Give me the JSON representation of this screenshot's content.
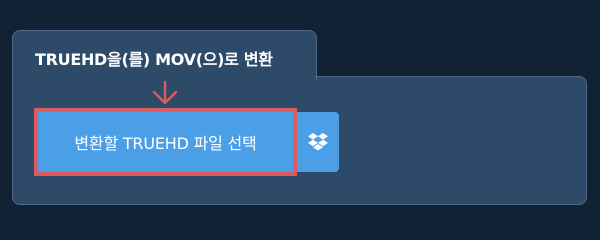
{
  "converter": {
    "tab_title": "TRUEHD을(를) MOV(으)로 변환",
    "choose_file_label": "변환할 TRUEHD 파일 선택",
    "dropbox_icon": "dropbox-icon",
    "arrow_icon": "arrow-down-icon"
  },
  "colors": {
    "background": "#102233",
    "panel": "#2d4a69",
    "button": "#4b9fe7",
    "highlight_border": "#dd5b5e",
    "arrow": "#dd5b5e"
  }
}
